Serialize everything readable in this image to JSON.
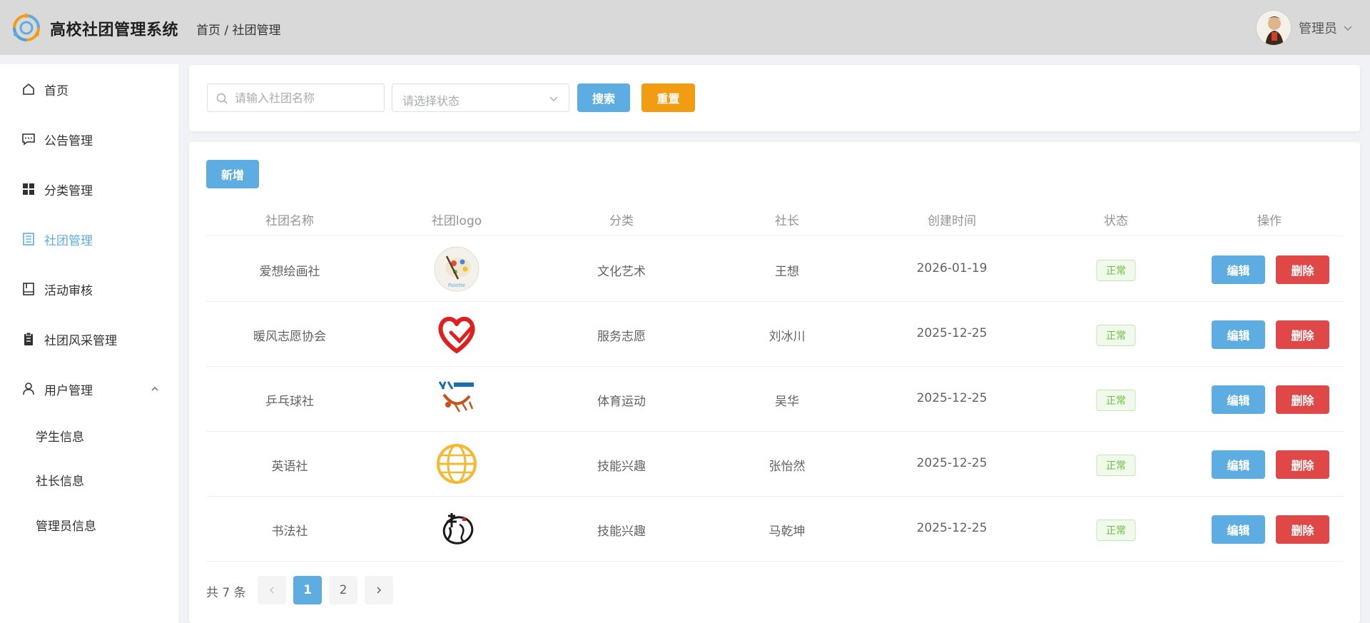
{
  "app": {
    "title": "高校社团管理系统"
  },
  "breadcrumb": "首页 / 社团管理",
  "user": {
    "name": "管理员"
  },
  "sidebar": {
    "items": [
      {
        "label": "首页",
        "icon": "home-icon"
      },
      {
        "label": "公告管理",
        "icon": "chat-icon"
      },
      {
        "label": "分类管理",
        "icon": "grid-icon"
      },
      {
        "label": "社团管理",
        "icon": "document-icon",
        "active": true
      },
      {
        "label": "活动审核",
        "icon": "book-icon"
      },
      {
        "label": "社团风采管理",
        "icon": "clipboard-icon"
      },
      {
        "label": "用户管理",
        "icon": "user-icon",
        "expanded": true
      }
    ],
    "subitems": [
      {
        "label": "学生信息"
      },
      {
        "label": "社长信息"
      },
      {
        "label": "管理员信息"
      }
    ]
  },
  "search": {
    "placeholder": "请输入社团名称",
    "status_placeholder": "请选择状态",
    "search_label": "搜索",
    "reset_label": "重置"
  },
  "table": {
    "add_label": "新增",
    "columns": [
      "社团名称",
      "社团logo",
      "分类",
      "社长",
      "创建时间",
      "状态",
      "操作"
    ],
    "rows": [
      {
        "name": "爱想绘画社",
        "logo": "painting-logo",
        "category": "文化艺术",
        "leader": "王想",
        "created": "2026-01-19",
        "status": "正常",
        "edit": "编辑",
        "delete": "删除"
      },
      {
        "name": "暖风志愿协会",
        "logo": "heart-logo",
        "category": "服务志愿",
        "leader": "刘冰川",
        "created": "2025-12-25",
        "status": "正常",
        "edit": "编辑",
        "delete": "删除"
      },
      {
        "name": "乒乓球社",
        "logo": "pingpong-logo",
        "category": "体育运动",
        "leader": "吴华",
        "created": "2025-12-25",
        "status": "正常",
        "edit": "编辑",
        "delete": "删除"
      },
      {
        "name": "英语社",
        "logo": "english-globe-logo",
        "category": "技能兴趣",
        "leader": "张怡然",
        "created": "2025-12-25",
        "status": "正常",
        "edit": "编辑",
        "delete": "删除"
      },
      {
        "name": "书法社",
        "logo": "calligraphy-logo",
        "category": "技能兴趣",
        "leader": "马乾坤",
        "created": "2025-12-25",
        "status": "正常",
        "edit": "编辑",
        "delete": "删除"
      }
    ]
  },
  "pagination": {
    "total": "共 7 条",
    "pages": [
      "1",
      "2"
    ],
    "current": "1"
  },
  "colors": {
    "primary": "#5dade2",
    "warning": "#f29c11",
    "danger": "#e04848",
    "success": "#67c23a",
    "header_bg": "#d9d9d9"
  }
}
